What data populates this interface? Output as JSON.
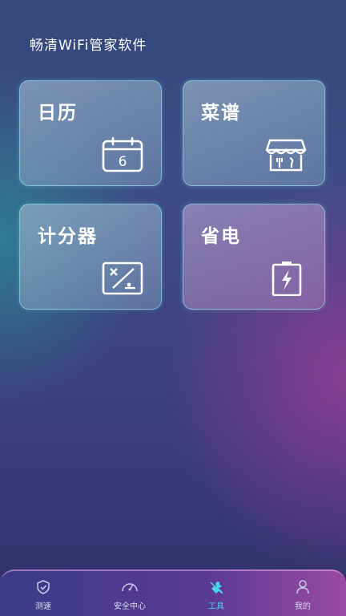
{
  "header": {
    "title": "畅清WiFi管家软件"
  },
  "tiles": [
    {
      "label": "日历",
      "icon": "calendar-icon",
      "icon_text": "6"
    },
    {
      "label": "菜谱",
      "icon": "shop-icon"
    },
    {
      "label": "计分器",
      "icon": "percent-icon"
    },
    {
      "label": "省电",
      "icon": "battery-charge-icon"
    }
  ],
  "tabbar": {
    "active": "工具",
    "tabs": [
      {
        "label": "测速",
        "icon": "shield-check-icon"
      },
      {
        "label": "安全中心",
        "icon": "speedometer-icon"
      },
      {
        "label": "工具",
        "icon": "tools-icon"
      },
      {
        "label": "我的",
        "icon": "user-icon"
      }
    ]
  },
  "colors": {
    "accent": "#4ad6ea",
    "tile_border": "#96ebf0"
  }
}
